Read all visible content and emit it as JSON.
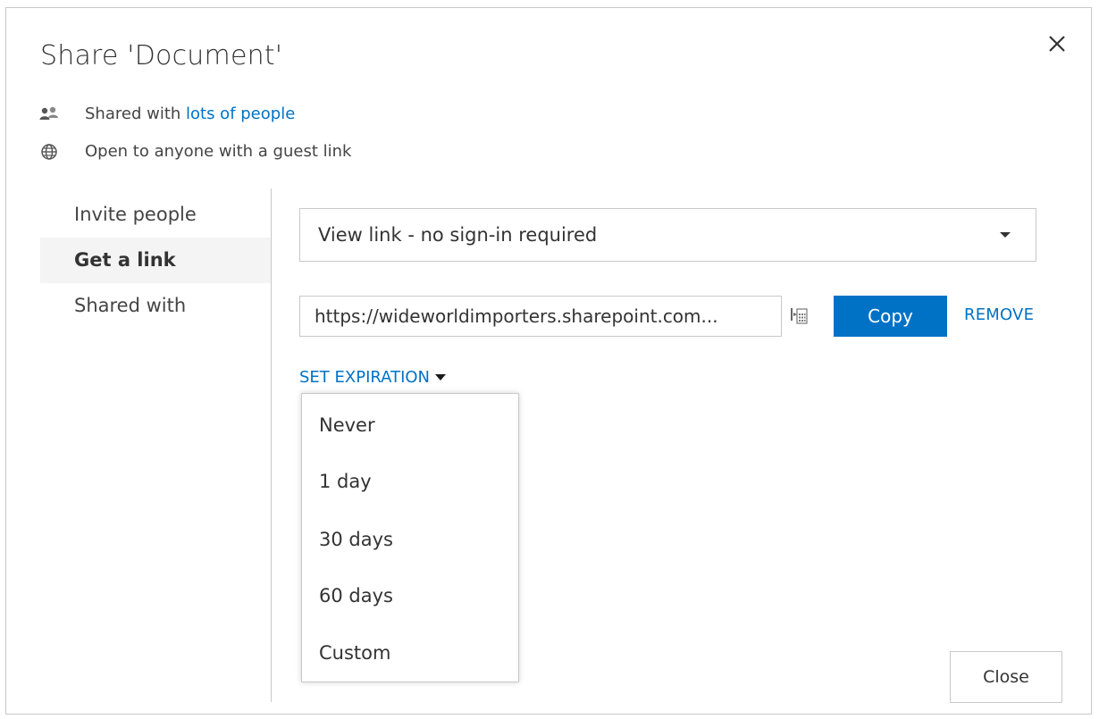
{
  "dialog": {
    "title": "Share 'Document'",
    "close_icon": "close-icon"
  },
  "info": {
    "shared_prefix": "Shared with ",
    "shared_link": "lots of people",
    "shared_icon": "people-icon",
    "guest_text": "Open to anyone with a guest link",
    "guest_icon": "globe-icon"
  },
  "nav": {
    "items": [
      {
        "label": "Invite people",
        "active": false
      },
      {
        "label": "Get a link",
        "active": true
      },
      {
        "label": "Shared with",
        "active": false
      }
    ]
  },
  "link_type": {
    "selected": "View link - no sign-in required"
  },
  "link": {
    "value": "https://wideworldimporters.sharepoint.com...",
    "qr_icon": "qr-code-icon",
    "copy_label": "Copy",
    "remove_label": "REMOVE"
  },
  "expiration": {
    "label": "SET EXPIRATION",
    "options": [
      "Never",
      "1 day",
      "30 days",
      "60 days",
      "Custom"
    ]
  },
  "footer": {
    "close_label": "Close"
  },
  "colors": {
    "accent": "#0072c6",
    "border": "#c8c8c8",
    "nav_active_bg": "#f4f4f4"
  }
}
